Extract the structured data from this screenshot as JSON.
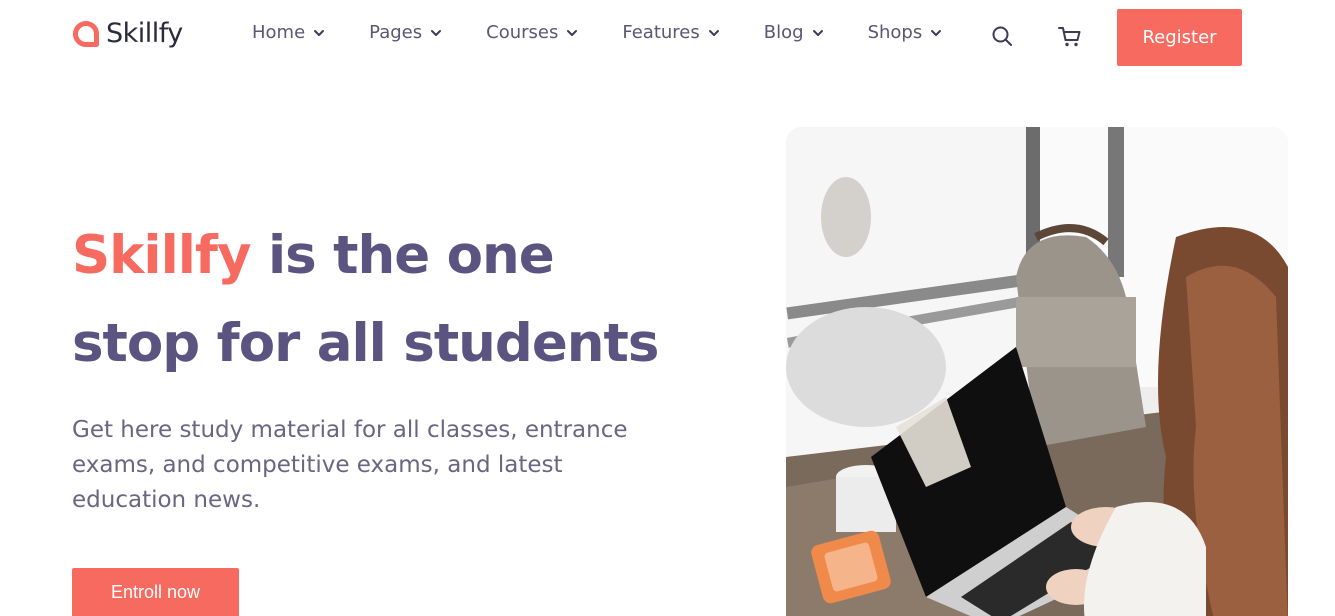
{
  "logo": {
    "text": "Skillfy",
    "icon": "skillfy-logo-icon"
  },
  "nav": {
    "items": [
      {
        "label": "Home"
      },
      {
        "label": "Pages"
      },
      {
        "label": "Courses"
      },
      {
        "label": "Features"
      },
      {
        "label": "Blog"
      },
      {
        "label": "Shops"
      }
    ]
  },
  "header": {
    "search_icon": "search-icon",
    "cart_icon": "cart-icon",
    "register_label": "Register"
  },
  "hero": {
    "title_accent": "Skillfy",
    "title_rest_line1": "is the one",
    "title_line2": "stop for all students",
    "subtitle": "Get here study material for all classes, entrance exams, and competitive exams, and latest education news.",
    "cta_label": "Entroll now"
  },
  "colors": {
    "accent": "#f76a60",
    "heading": "#5b5380",
    "body_text": "#6a6682",
    "nav_text": "#5b5672"
  }
}
